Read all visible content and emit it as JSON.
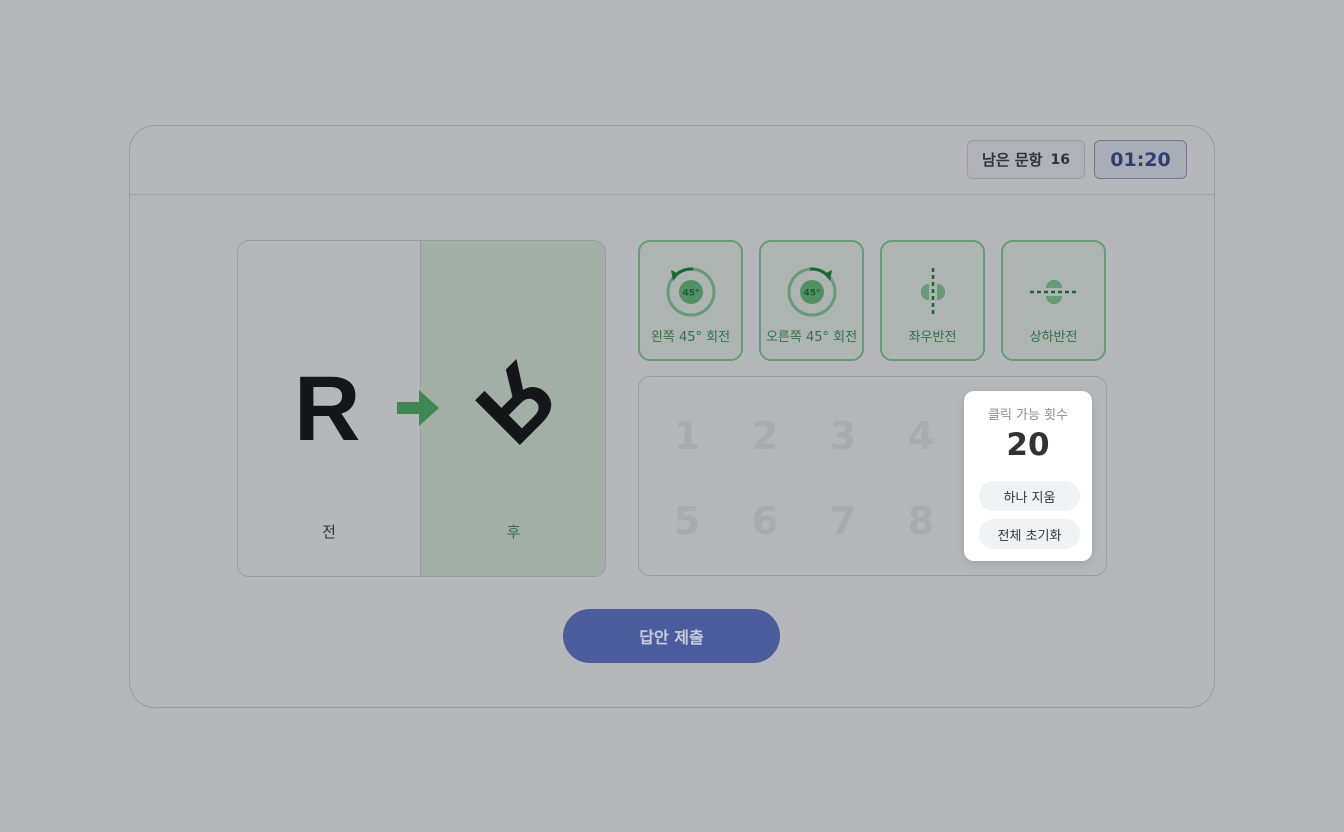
{
  "header": {
    "remaining_label": "남은 문항",
    "remaining_count": "16",
    "timer": "01:20"
  },
  "example": {
    "before_letter": "R",
    "after_letter": "R",
    "before_label": "전",
    "after_label": "후",
    "arrow_icon": "right-arrow-icon"
  },
  "operations": [
    {
      "label": "왼쪽 45° 회전",
      "icon": "rotate-left-45-icon",
      "badge": "45°"
    },
    {
      "label": "오른쪽 45° 회전",
      "icon": "rotate-right-45-icon",
      "badge": "45°"
    },
    {
      "label": "좌우반전",
      "icon": "flip-horizontal-icon"
    },
    {
      "label": "상하반전",
      "icon": "flip-vertical-icon"
    }
  ],
  "slots": [
    "1",
    "2",
    "3",
    "4",
    "5",
    "6",
    "7",
    "8"
  ],
  "popup": {
    "title": "클릭 가능 횟수",
    "count": "20",
    "undo_label": "하나 지움",
    "reset_label": "전체 초기화"
  },
  "submit_label": "답안 제출",
  "colors": {
    "accent_green": "#3f9a56",
    "accent_blue": "#4a5c9c",
    "timer_text": "#3c4f97"
  }
}
